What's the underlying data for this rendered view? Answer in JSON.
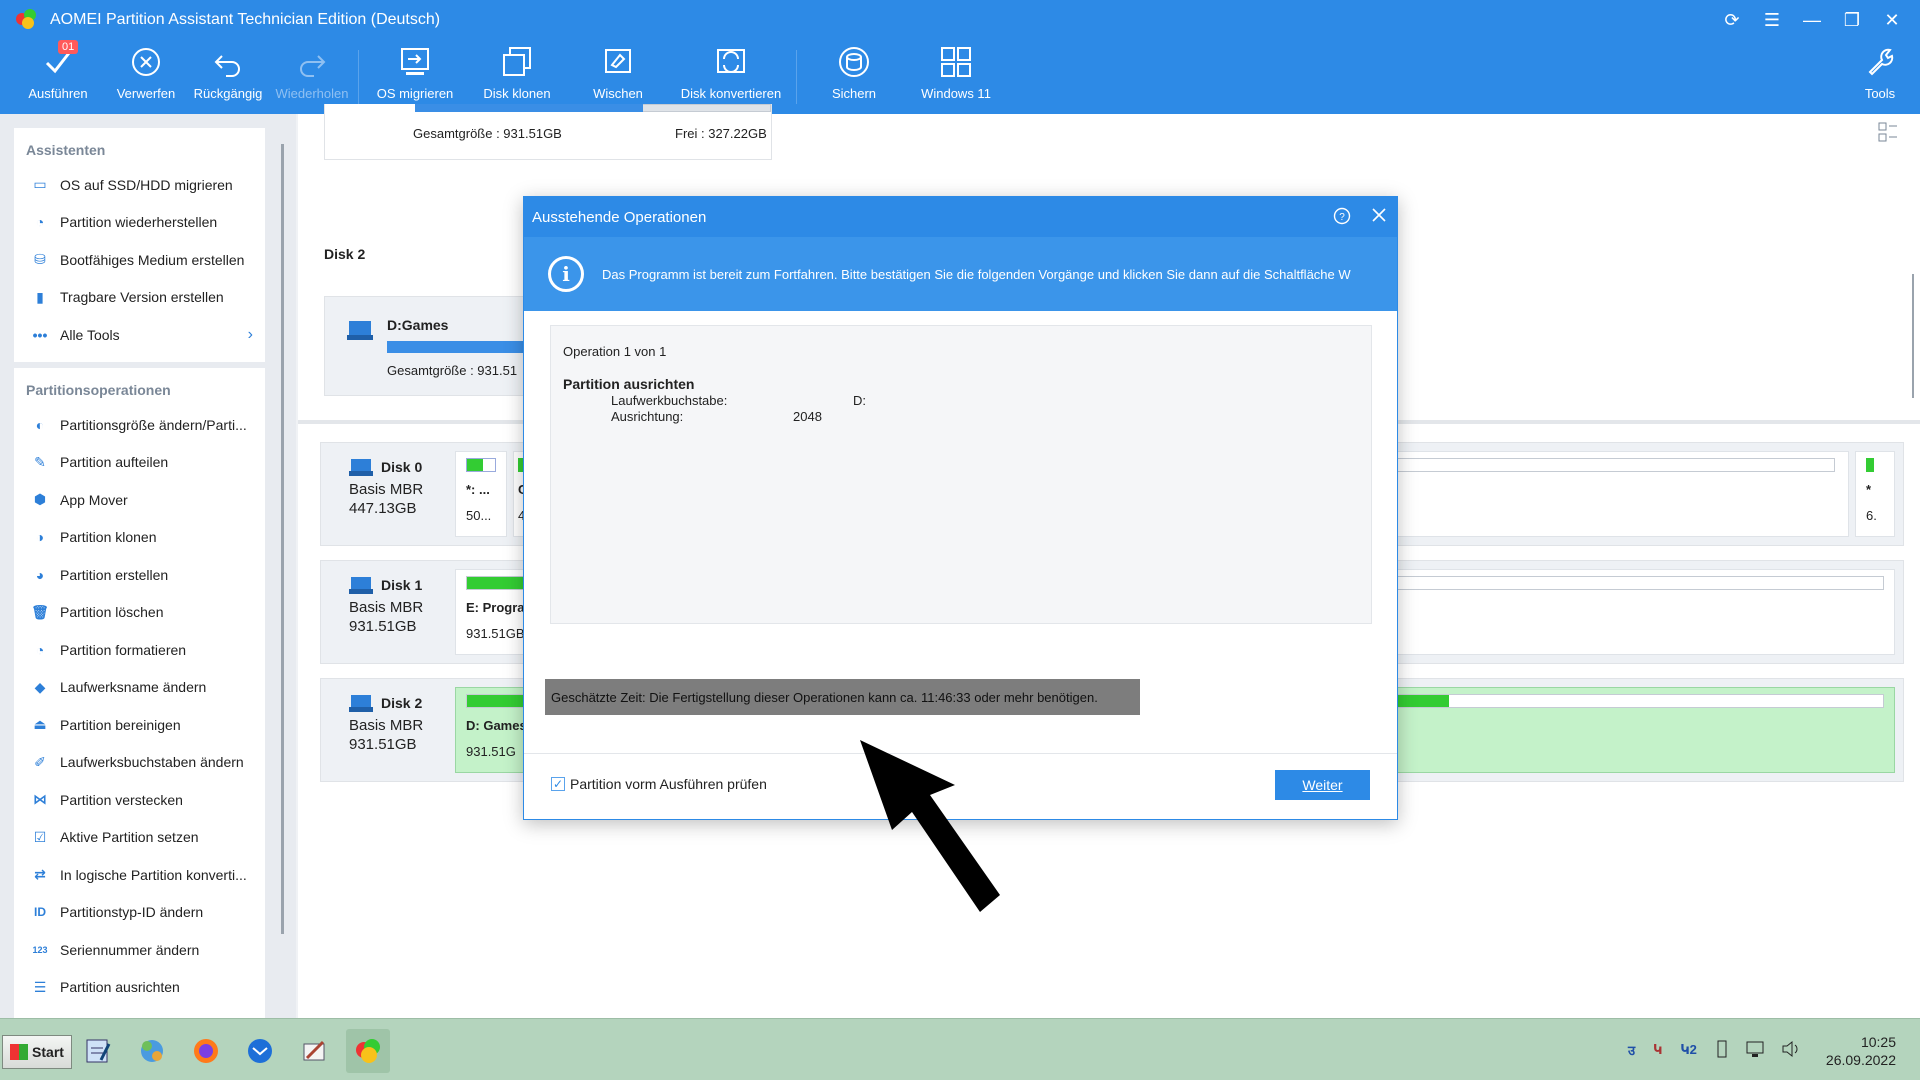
{
  "window": {
    "title": "AOMEI Partition Assistant Technician Edition (Deutsch)"
  },
  "toolbar": {
    "ausfuehren": "Ausführen",
    "badge": "01",
    "verwerfen": "Verwerfen",
    "rueckgaengig": "Rückgängig",
    "wiederholen": "Wiederholen",
    "os_migrieren": "OS migrieren",
    "disk_klonen": "Disk klonen",
    "wischen": "Wischen",
    "disk_konvertieren": "Disk konvertieren",
    "sichern": "Sichern",
    "windows11": "Windows 11",
    "tools": "Tools"
  },
  "sidebar": {
    "assistenten_heading": "Assistenten",
    "assistenten": [
      {
        "label": "OS auf SSD/HDD migrieren",
        "icon": "migrate-icon"
      },
      {
        "label": "Partition wiederherstellen",
        "icon": "recover-icon"
      },
      {
        "label": "Bootfähiges Medium erstellen",
        "icon": "bootable-media-icon"
      },
      {
        "label": "Tragbare Version erstellen",
        "icon": "portable-icon"
      },
      {
        "label": "Alle Tools",
        "icon": "more-icon"
      }
    ],
    "partitionsoperationen_heading": "Partitionsoperationen",
    "operationen": [
      {
        "label": "Partitionsgröße ändern/Parti...",
        "icon": "resize-icon"
      },
      {
        "label": "Partition aufteilen",
        "icon": "split-icon"
      },
      {
        "label": "App Mover",
        "icon": "app-mover-icon"
      },
      {
        "label": "Partition klonen",
        "icon": "clone-icon"
      },
      {
        "label": "Partition erstellen",
        "icon": "create-icon"
      },
      {
        "label": "Partition löschen",
        "icon": "delete-icon"
      },
      {
        "label": "Partition formatieren",
        "icon": "format-icon"
      },
      {
        "label": "Laufwerksname ändern",
        "icon": "label-icon"
      },
      {
        "label": "Partition bereinigen",
        "icon": "wipe-icon"
      },
      {
        "label": "Laufwerksbuchstaben ändern",
        "icon": "drive-letter-icon"
      },
      {
        "label": "Partition verstecken",
        "icon": "hide-icon"
      },
      {
        "label": "Aktive Partition setzen",
        "icon": "active-icon"
      },
      {
        "label": "In logische Partition konverti...",
        "icon": "convert-icon"
      },
      {
        "label": "Partitionstyp-ID ändern",
        "icon": "id-icon"
      },
      {
        "label": "Seriennummer ändern",
        "icon": "serial-icon"
      },
      {
        "label": "Partition ausrichten",
        "icon": "align-icon"
      }
    ]
  },
  "main": {
    "top_card": {
      "total": "Gesamtgröße : 931.51GB",
      "free": "Frei : 327.22GB"
    },
    "disk2_label": "Disk 2",
    "disk2_card": {
      "name": "D:Games",
      "total": "Gesamtgröße : 931.51"
    },
    "disks": [
      {
        "name": "Disk 0",
        "type": "Basis MBR",
        "size": "447.13GB",
        "p1_top": "*: ...",
        "p1_bottom": "50...",
        "p2_top": "C",
        "p2_bottom": "4",
        "right_top": "*",
        "right_bottom": "6."
      },
      {
        "name": "Disk 1",
        "type": "Basis MBR",
        "size": "931.51GB",
        "p1_top": "E: Progra",
        "p1_bottom": "931.51GB"
      },
      {
        "name": "Disk 2",
        "type": "Basis MBR",
        "size": "931.51GB",
        "p1_top": "D: Games",
        "p1_bottom": "931.51G"
      }
    ]
  },
  "dialog": {
    "title": "Ausstehende Operationen",
    "info": "Das Programm ist bereit zum Fortfahren. Bitte bestätigen Sie die folgenden Vorgänge und klicken Sie dann auf die Schaltfläche W",
    "op_count": "Operation 1 von 1",
    "op_name": "Partition ausrichten",
    "field1_label": "Laufwerkbuchstabe:",
    "field1_value": "D:",
    "field2_label": "Ausrichtung:",
    "field2_value": "2048",
    "estimate": "Geschätzte Zeit: Die Fertigstellung dieser Operationen kann ca. 11:46:33 oder mehr benötigen.",
    "checkbox_label": "Partition vorm Ausführen prüfen",
    "continue": "Weiter"
  },
  "taskbar": {
    "start": "Start",
    "tray_lang1": "उ",
    "tray_lang2": "Կ",
    "tray_lang3": "Կ2",
    "time": "10:25",
    "date": "26.09.2022"
  },
  "colors": {
    "accent": "#2d8ae6",
    "taskbar": "#b4d4bd",
    "partition_green": "#c4f2c9"
  }
}
